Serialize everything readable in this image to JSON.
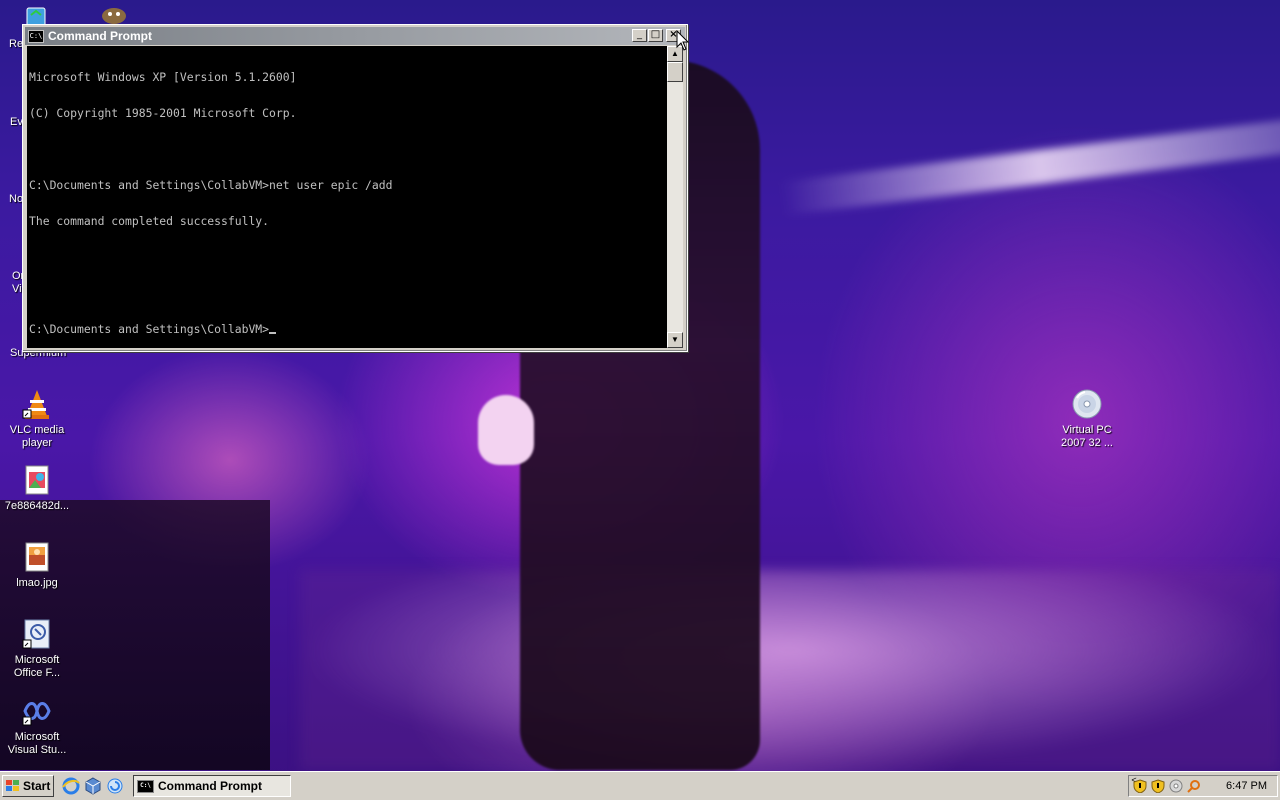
{
  "desktop": {
    "partial_labels": [
      "Re",
      "Ev",
      "No",
      "Or",
      "Vi",
      "Supermium"
    ],
    "icons": [
      {
        "label": "VLC media player",
        "icon": "vlc-cone-icon"
      },
      {
        "label": "7e886482d...",
        "icon": "image-file-icon"
      },
      {
        "label": "lmao.jpg",
        "icon": "image-file-icon"
      },
      {
        "label": "Microsoft Office F...",
        "icon": "office-shortcut-icon"
      },
      {
        "label": "Microsoft Visual Stu...",
        "icon": "visual-studio-icon"
      },
      {
        "label": "Virtual PC 2007 32 ...",
        "icon": "cd-disc-icon"
      }
    ]
  },
  "cmd": {
    "title": "Command Prompt",
    "icon_text": "C:\\",
    "buttons": {
      "minimize": "_",
      "maximize": "□",
      "close": "×"
    },
    "lines": [
      "Microsoft Windows XP [Version 5.1.2600]",
      "(C) Copyright 1985-2001 Microsoft Corp.",
      "",
      "C:\\Documents and Settings\\CollabVM>net user epic /add",
      "The command completed successfully.",
      "",
      "",
      "C:\\Documents and Settings\\CollabVM>"
    ],
    "scroll": {
      "up": "▲",
      "down": "▼"
    }
  },
  "taskbar": {
    "start_label": "Start",
    "quick_launch": [
      "internet-explorer-icon",
      "network-icon",
      "show-desktop-icon"
    ],
    "task_button": {
      "label": "Command Prompt"
    },
    "tray_toggle": "<",
    "tray_icons": [
      "security-shield-icon",
      "security-shield-icon",
      "network-tray-icon",
      "search-tray-icon"
    ],
    "clock": "6:47 PM"
  },
  "colors": {
    "console_bg": "#000000",
    "console_fg": "#c0c0c0",
    "titlebar_inactive": "#7a7f86",
    "taskbar": "#d4d0c8"
  }
}
